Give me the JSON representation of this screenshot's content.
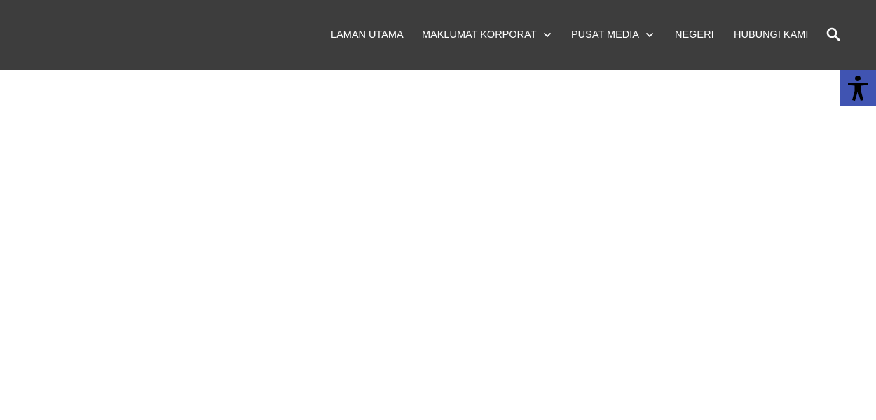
{
  "header": {
    "background_color": "#3d3d3d",
    "nav": [
      {
        "label": "LAMAN UTAMA",
        "has_dropdown": false
      },
      {
        "label": "MAKLUMAT KORPORAT",
        "has_dropdown": true
      },
      {
        "label": "PUSAT MEDIA",
        "has_dropdown": true
      },
      {
        "label": "NEGERI",
        "has_dropdown": false
      },
      {
        "label": "HUBUNGI KAMI",
        "has_dropdown": false
      }
    ],
    "search_icon": "search-icon"
  },
  "accessibility": {
    "icon": "accessibility-icon",
    "color": "#4054b2"
  }
}
